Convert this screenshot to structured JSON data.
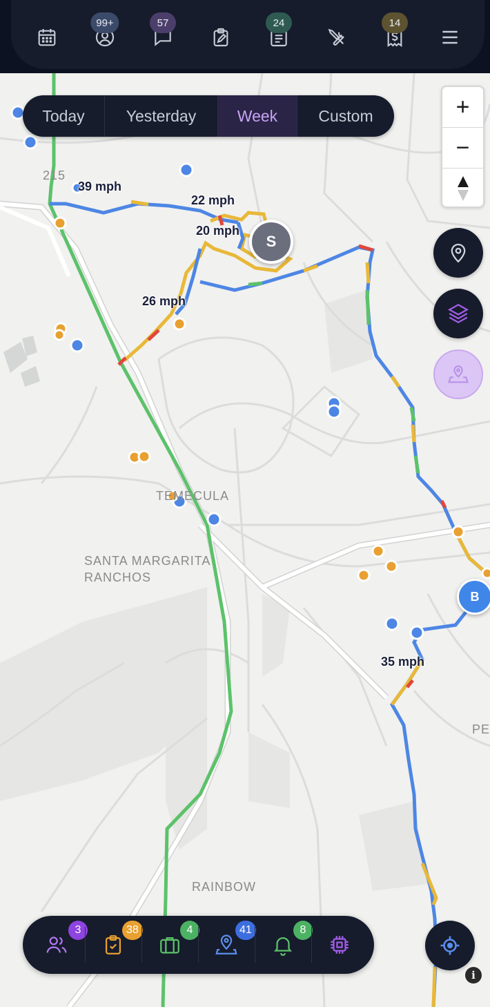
{
  "top_nav": {
    "items": [
      {
        "icon": "calendar-icon",
        "badge": null
      },
      {
        "icon": "user-circle-icon",
        "badge": "99+",
        "badge_color": "#3c4a6a"
      },
      {
        "icon": "chat-bubble-icon",
        "badge": "57",
        "badge_color": "#4c3e6a"
      },
      {
        "icon": "clipboard-edit-icon",
        "badge": null
      },
      {
        "icon": "document-list-icon",
        "badge": "24",
        "badge_color": "#2e5a52"
      },
      {
        "icon": "tools-icon",
        "badge": null
      },
      {
        "icon": "receipt-dollar-icon",
        "badge": "14",
        "badge_color": "#5e5330"
      },
      {
        "icon": "menu-icon",
        "badge": null
      }
    ]
  },
  "date_range": {
    "tabs": [
      "Today",
      "Yesterday",
      "Week",
      "Custom"
    ],
    "selected": "Week"
  },
  "zoom": {
    "in_label": "+",
    "out_label": "−"
  },
  "map": {
    "place_labels": {
      "highway": "215",
      "temecula": "TEMECULA",
      "santa_margarita": "SANTA MARGARITA\nRANCHOS",
      "rainbow": "RAINBOW",
      "pe": "PE"
    },
    "speed_labels": [
      "39 mph",
      "22 mph",
      "20 mph",
      "26 mph",
      "35 mph"
    ],
    "vehicles": [
      {
        "label": "S",
        "color": "#6b6e7d"
      },
      {
        "label": "B",
        "color": "#3f86e8"
      }
    ]
  },
  "colors": {
    "route_blue": "#4d86e4",
    "route_green": "#5cc26a",
    "route_yellow": "#e8b838",
    "route_red": "#e0473b",
    "stop_blue": "#4d86e4",
    "stop_orange": "#e8a030",
    "accent_purple": "#a15de6"
  },
  "bottom_nav": {
    "items": [
      {
        "icon": "users-icon",
        "badge": "3",
        "badge_color": "#8e44e0",
        "icon_color": "#b277f0"
      },
      {
        "icon": "clipboard-check-icon",
        "badge": "38",
        "badge_color": "#e8a030",
        "icon_color": "#e8a030"
      },
      {
        "icon": "briefcase-icon",
        "badge": "4",
        "badge_color": "#4cb263",
        "icon_color": "#5cc26a"
      },
      {
        "icon": "map-pin-person-icon",
        "badge": "41",
        "badge_color": "#3d6ee0",
        "icon_color": "#5b8eee"
      },
      {
        "icon": "bell-icon",
        "badge": "8",
        "badge_color": "#4cb263",
        "icon_color": "#5cc26a"
      },
      {
        "icon": "chip-icon",
        "badge": null,
        "icon_color": "#a15de6"
      }
    ]
  }
}
